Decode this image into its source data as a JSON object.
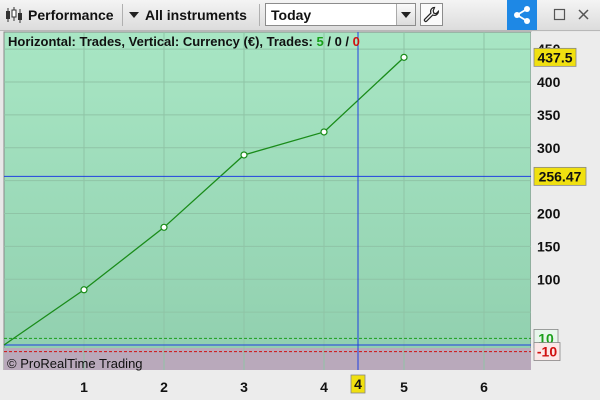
{
  "toolbar": {
    "app_title": "Performance",
    "scope_label": "All instruments",
    "period_selected": "Today",
    "colors": {
      "share_bg": "#1e88e5"
    },
    "icons": [
      "candlestick-icon",
      "chevron-down-icon",
      "wrench-icon",
      "share-icon",
      "restore-window-icon",
      "close-icon"
    ]
  },
  "chart": {
    "title_prefix": "Horizontal: Trades, Vertical: Currency (€), Trades: ",
    "wins": "5",
    "sep1": " / ",
    "neutral": "0",
    "sep2": " / ",
    "losses": "0",
    "watermark": "© ProRealTime Trading",
    "crosshair_x_label": "4",
    "crosshair_y_label": "256.47",
    "last_value_label": "437.5",
    "upper_threshold_label": "10",
    "lower_threshold_label": "-10",
    "colors": {
      "line": "#1a8c1a",
      "crosshair": "#2040e0",
      "highlight": "#f0e010",
      "upper": "#1aa01a",
      "lower": "#d01010"
    }
  },
  "chart_data": {
    "type": "line",
    "x": [
      0,
      1,
      2,
      3,
      4,
      5
    ],
    "values": [
      0,
      84,
      179,
      289,
      324,
      437.5
    ],
    "xticks": [
      "1",
      "2",
      "3",
      "4",
      "5",
      "6"
    ],
    "yticks": [
      "100",
      "150",
      "200",
      "250",
      "300",
      "350",
      "400",
      "450"
    ],
    "ylim": [
      -20,
      460
    ],
    "grid": true
  }
}
